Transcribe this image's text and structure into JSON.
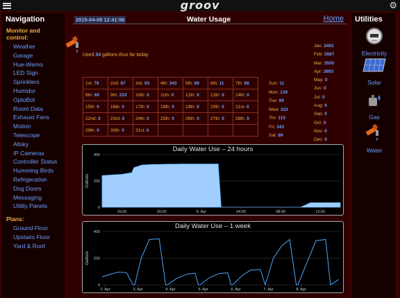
{
  "topbar": {
    "logo": "groov"
  },
  "nav": {
    "title": "Navigation",
    "monitor_label": "Monitor and control:",
    "monitor_items": [
      "Weather",
      "Garage",
      "Hue-Wemo",
      "LED Sign",
      "Sprinklers",
      "Humidor",
      "OptoBot",
      "Room Data",
      "Exhaust Fans",
      "Motion",
      "Telescope",
      "Allsky",
      "IP Cameras",
      "Controller Status",
      "Humming Birds",
      "Refrigeration",
      "Dog Doors",
      "Messaging",
      "Utility Panels"
    ],
    "plans_label": "Plans:",
    "plans_items": [
      "Ground Floor",
      "Upstairs Floor",
      "Yard & Roof"
    ]
  },
  "header": {
    "timestamp": "2015-04-08 12:41:56",
    "title": "Water Usage",
    "home": "Home"
  },
  "usage": {
    "prefix": "Used",
    "gallons": "34",
    "suffix": "gallons thus far today"
  },
  "days": [
    [
      "1st:",
      "79"
    ],
    [
      "2nd:",
      "87"
    ],
    [
      "3rd:",
      "93"
    ],
    [
      "4th:",
      "343"
    ],
    [
      "5th:",
      "89"
    ],
    [
      "6th:",
      "11"
    ],
    [
      "7th:",
      "86"
    ],
    [
      "8th:",
      "69"
    ],
    [
      "9th:",
      "333"
    ],
    [
      "10th:",
      "0"
    ],
    [
      "11th:",
      "0"
    ],
    [
      "12th:",
      "0"
    ],
    [
      "13th:",
      "0"
    ],
    [
      "14th:",
      "0"
    ],
    [
      "15th:",
      "0"
    ],
    [
      "16th:",
      "0"
    ],
    [
      "17th:",
      "0"
    ],
    [
      "18th:",
      "0"
    ],
    [
      "19th:",
      "0"
    ],
    [
      "20th:",
      "0"
    ],
    [
      "21st:",
      "0"
    ],
    [
      "22nd:",
      "0"
    ],
    [
      "23rd:",
      "0"
    ],
    [
      "24th:",
      "0"
    ],
    [
      "25th:",
      "0"
    ],
    [
      "26th:",
      "0"
    ],
    [
      "27th:",
      "0"
    ],
    [
      "28th:",
      "0"
    ],
    [
      "29th:",
      "0"
    ],
    [
      "30th:",
      "0"
    ],
    [
      "31st:",
      "0"
    ],
    [
      "",
      ""
    ],
    [
      "",
      ""
    ],
    [
      "",
      ""
    ],
    [
      "",
      ""
    ]
  ],
  "weekdays": [
    [
      "Sun:",
      "11"
    ],
    [
      "Mon:",
      "139"
    ],
    [
      "Tue:",
      "69"
    ],
    [
      "Wed:",
      "333"
    ],
    [
      "Thr:",
      "115"
    ],
    [
      "Fri:",
      "343"
    ],
    [
      "Sat:",
      "89"
    ]
  ],
  "months": [
    [
      "Jan:",
      "3402"
    ],
    [
      "Feb:",
      "3567"
    ],
    [
      "Mar:",
      "3500"
    ],
    [
      "Apr:",
      "3893"
    ],
    [
      "May:",
      "0"
    ],
    [
      "Jun:",
      "0"
    ],
    [
      "Jul:",
      "0"
    ],
    [
      "Aug:",
      "0"
    ],
    [
      "Sep:",
      "0"
    ],
    [
      "Oct:",
      "0"
    ],
    [
      "Nov:",
      "0"
    ],
    [
      "Dec:",
      "0"
    ]
  ],
  "utilities": {
    "title": "Utilities",
    "items": [
      {
        "label": "Electricity",
        "icon": "electricity-meter-icon"
      },
      {
        "label": "Solar",
        "icon": "solar-panel-icon"
      },
      {
        "label": "Gas",
        "icon": "gas-icon"
      },
      {
        "label": "Water",
        "icon": "water-faucet-icon"
      }
    ]
  },
  "chart_data": [
    {
      "type": "area",
      "title": "Daily Water Use – 24 hours",
      "ylabel": "Gallons",
      "ylim": [
        0,
        400
      ],
      "yticks": [
        0,
        200,
        400
      ],
      "xticks": [
        "16:00",
        "20:00",
        "8. Apr",
        "04:00",
        "08:00",
        "12:00"
      ],
      "x": [
        0,
        1,
        2,
        3,
        3.2,
        4,
        5,
        6,
        6.5,
        7,
        8,
        9,
        10,
        11,
        11.7,
        12,
        13,
        14,
        15,
        16,
        17,
        18,
        19,
        20,
        21,
        22,
        23,
        24
      ],
      "values": [
        240,
        245,
        250,
        262,
        300,
        320,
        325,
        326,
        327,
        327,
        328,
        328,
        328,
        328,
        328,
        0,
        0,
        0,
        0,
        0,
        0,
        0,
        0,
        0,
        34,
        34,
        34,
        34
      ],
      "color": "#a0cfff"
    },
    {
      "type": "line",
      "title": "Daily Water Use – 1 week",
      "ylabel": "Gallons",
      "ylim": [
        0,
        400
      ],
      "yticks": [
        0,
        200,
        400
      ],
      "xticks": [
        "2. Apr",
        "3. Apr",
        "4. Apr",
        "5. Apr",
        "6. Apr",
        "7. Apr",
        "8. Apr"
      ],
      "x": [
        0,
        0.25,
        0.5,
        0.75,
        0.95,
        1.0,
        1.2,
        1.45,
        1.75,
        1.95,
        2.0,
        2.3,
        2.6,
        2.85,
        2.95,
        3.0,
        3.3,
        3.6,
        3.85,
        3.95,
        4.0,
        4.3,
        4.55,
        4.85,
        5.0,
        5.25,
        5.5,
        5.75,
        5.95,
        6.0,
        6.3,
        6.55,
        6.85,
        7.0,
        7.25
      ],
      "values": [
        60,
        80,
        95,
        92,
        0,
        0,
        200,
        340,
        345,
        0,
        0,
        50,
        80,
        88,
        0,
        0,
        55,
        85,
        90,
        0,
        0,
        70,
        110,
        115,
        0,
        200,
        290,
        340,
        0,
        0,
        180,
        330,
        340,
        0,
        40
      ],
      "color": "#4aa8ff"
    }
  ]
}
